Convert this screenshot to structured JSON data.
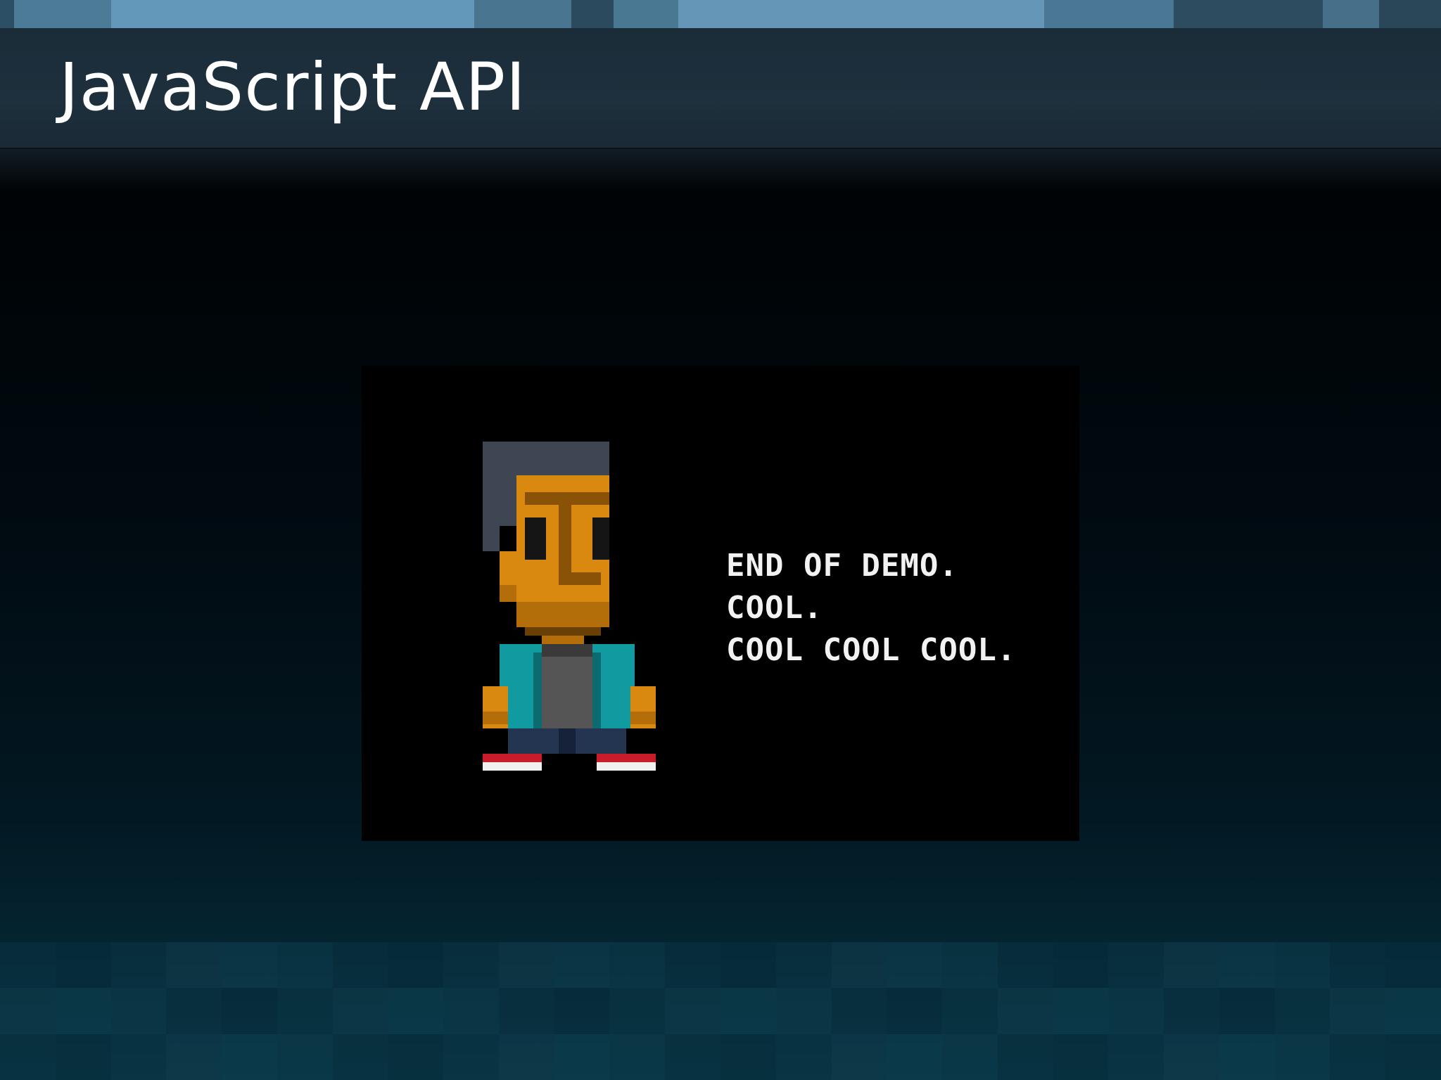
{
  "slide": {
    "title": "JavaScript API"
  },
  "demo": {
    "lines": [
      "END OF DEMO.",
      "COOL.",
      "COOL COOL COOL."
    ]
  },
  "colors": {
    "title_text": "#ffffff",
    "title_bar": "#1e303d",
    "sprite_skin": "#d9890f",
    "sprite_skin_shadow": "#b36e0a",
    "sprite_hair": "#3d4652",
    "sprite_jacket": "#119aa0",
    "sprite_shirt": "#555555",
    "sprite_pants": "#243552",
    "sprite_shoe": "#c81c2a"
  }
}
